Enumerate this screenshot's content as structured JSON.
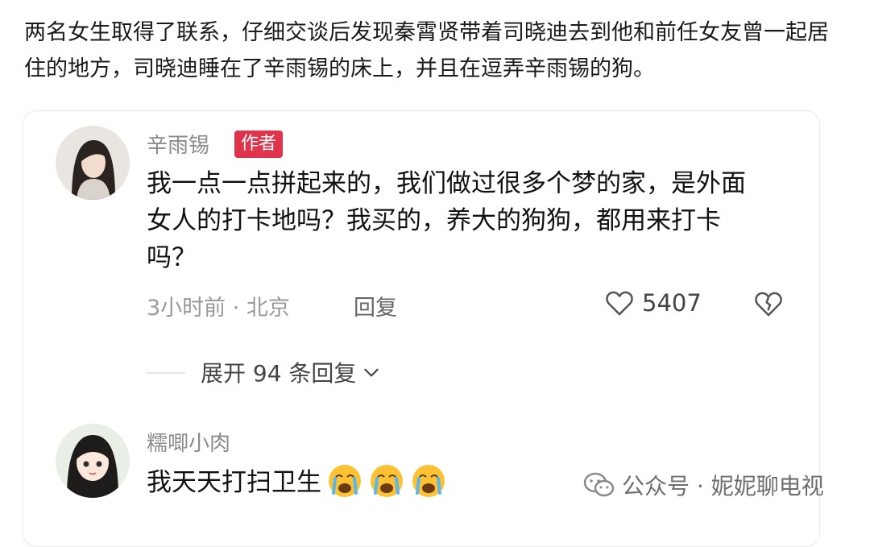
{
  "article": {
    "text": "两名女生取得了联系，仔细交谈后发现秦霄贤带着司晓迪去到他和前任女友曾一起居住的地方，司晓迪睡在了辛雨锡的床上，并且在逗弄辛雨锡的狗。"
  },
  "comment1": {
    "username": "辛雨锡",
    "badge": "作者",
    "body": "我一点一点拼起来的，我们做过很多个梦的家，是外面女人的打卡地吗？我买的，养大的狗狗，都用来打卡吗？",
    "meta": "3小时前 · 北京",
    "reply_label": "回复",
    "like_count": "5407",
    "icons": [
      "heart-outline-icon",
      "broken-heart-icon"
    ]
  },
  "expand": {
    "label": "展开 94 条回复",
    "icon": "chevron-down-icon"
  },
  "comment2": {
    "username": "糯唧小肉",
    "body": "我天天打扫卫生",
    "emojis": [
      "crying-face-icon",
      "crying-face-icon",
      "crying-face-icon"
    ]
  },
  "watermark": {
    "text": "公众号 · 妮妮聊电视",
    "icon": "wechat-icon"
  }
}
